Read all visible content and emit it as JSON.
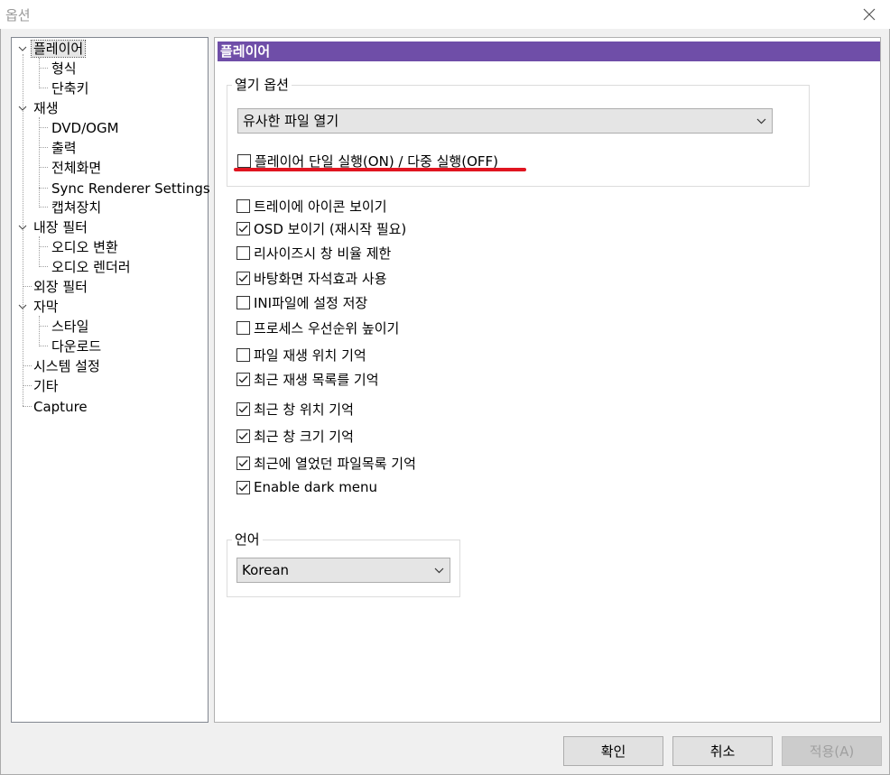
{
  "window": {
    "title": "옵션"
  },
  "tree": {
    "items": [
      {
        "label": "플레이어",
        "expanded": true,
        "selected": true
      },
      {
        "label": "형식"
      },
      {
        "label": "단축키"
      },
      {
        "label": "재생",
        "expanded": true
      },
      {
        "label": "DVD/OGM"
      },
      {
        "label": "출력"
      },
      {
        "label": "전체화면"
      },
      {
        "label": "Sync Renderer Settings"
      },
      {
        "label": "캡쳐장치"
      },
      {
        "label": "내장 필터",
        "expanded": true
      },
      {
        "label": "오디오 변환"
      },
      {
        "label": "오디오 렌더러"
      },
      {
        "label": "외장 필터"
      },
      {
        "label": "자막",
        "expanded": true
      },
      {
        "label": "스타일"
      },
      {
        "label": "다운로드"
      },
      {
        "label": "시스템 설정"
      },
      {
        "label": "기타"
      },
      {
        "label": "Capture"
      }
    ]
  },
  "panel": {
    "header": "플레이어",
    "open_options": {
      "title": "열기 옵션",
      "combo_value": "유사한 파일 열기",
      "single_instance": {
        "label": "플레이어 단일 실행(ON) / 다중 실행(OFF)",
        "checked": false
      }
    },
    "checkboxes": [
      {
        "label": "트레이에 아이콘 보이기",
        "checked": false
      },
      {
        "label": "OSD 보이기 (재시작 필요)",
        "checked": true
      },
      {
        "label": "리사이즈시 창 비율 제한",
        "checked": false
      },
      {
        "label": "바탕화면 자석효과 사용",
        "checked": true
      },
      {
        "label": "INI파일에 설정 저장",
        "checked": false
      },
      {
        "label": "프로세스 우선순위 높이기",
        "checked": false
      },
      {
        "label": "파일 재생 위치 기억",
        "checked": false
      },
      {
        "label": "최근 재생 목록를 기억",
        "checked": true
      },
      {
        "label": "최근 창 위치 기억",
        "checked": true
      },
      {
        "label": "최근 창 크기 기억",
        "checked": true
      },
      {
        "label": "최근에 열었던 파일목록 기억",
        "checked": true
      },
      {
        "label": "Enable dark menu",
        "checked": true
      }
    ],
    "language": {
      "title": "언어",
      "value": "Korean"
    }
  },
  "buttons": {
    "ok": "확인",
    "cancel": "취소",
    "apply": "적용(A)"
  },
  "colors": {
    "header_bg": "#6f4ea8",
    "highlight_underline": "#e01520"
  }
}
